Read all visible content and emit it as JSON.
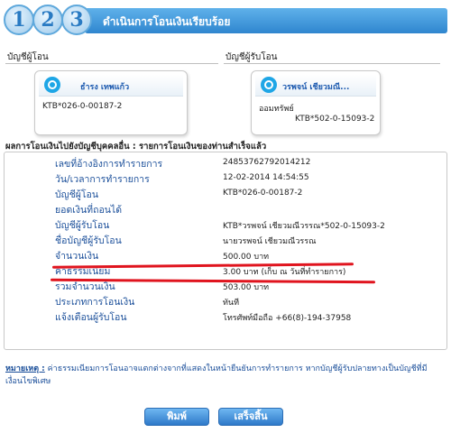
{
  "header": {
    "steps": [
      "1",
      "2",
      "3"
    ],
    "title": "ดำเนินการโอนเงินเรียบร้อย"
  },
  "from_account": {
    "label": "บัญชีผู้โอน",
    "owner_name": "ธำรง เทพแก้ว",
    "account": "KTB*026-0-00187-2",
    "icon": "krungthai-bank-logo"
  },
  "to_account": {
    "label": "บัญชีผู้รับโอน",
    "owner_name": "วรพจน์ เชียวมณี...",
    "account_type": "ออมทรัพย์",
    "account": "KTB*502-0-15093-2",
    "icon": "krungthai-bank-logo"
  },
  "result": {
    "title": "ผลการโอนเงินไปยังบัญชีบุคคลอื่น  :  รายการโอนเงินของท่านสำเร็จแล้ว",
    "rows": [
      {
        "label": "เลขที่อ้างอิงการทำรายการ",
        "value": "24853762792014212"
      },
      {
        "label": "วัน/เวลาการทำรายการ",
        "value": "12-02-2014 14:54:55"
      },
      {
        "label": "บัญชีผู้โอน",
        "value": "KTB*026-0-00187-2"
      },
      {
        "label": "ยอดเงินที่ถอนได้",
        "value": ""
      },
      {
        "label": "บัญชีผู้รับโอน",
        "value": "KTB*วรพจน์ เชียวมณีวรรณ*502-0-15093-2"
      },
      {
        "label": "ชื่อบัญชีผู้รับโอน",
        "value": "นายวรพจน์ เชียวมณีวรรณ"
      },
      {
        "label": "จำนวนเงิน",
        "value": "500.00 บาท"
      },
      {
        "label": "ค่าธรรมเนียม",
        "value": "3.00 บาท (เก็บ ณ วันที่ทำรายการ)"
      },
      {
        "label": "รวมจำนวนเงิน",
        "value": "503.00 บาท"
      },
      {
        "label": "ประเภทการโอนเงิน",
        "value": "ทันที"
      },
      {
        "label": "แจ้งเตือนผู้รับโอน",
        "value": "โทรศัพท์มือถือ +66(8)-194-37958"
      }
    ]
  },
  "note": {
    "label": "หมายเหตุ :",
    "text": "ค่าธรรมเนียมการโอนอาจแตกต่างจากที่แสดงในหน้ายืนยันการทำรายการ หากบัญชีผู้รับปลายทางเป็นบัญชีที่มีเงื่อนไขพิเศษ"
  },
  "buttons": {
    "print": "พิมพ์",
    "done": "เสร็จสิ้น"
  },
  "colors": {
    "accent": "#2f86cf",
    "label_text": "#1b4f9a",
    "highlight_underline": "#e0141e"
  }
}
